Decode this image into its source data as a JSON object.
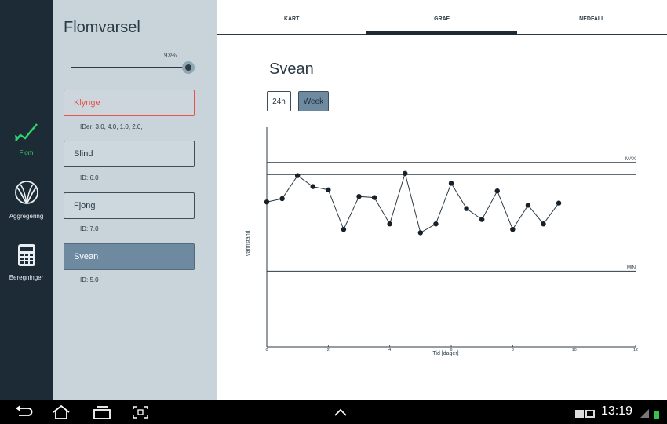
{
  "nav": {
    "items": [
      {
        "label": "Flom",
        "icon": "flood-line-icon",
        "active": true
      },
      {
        "label": "Aggregering",
        "icon": "aggregate-circles-icon",
        "active": false
      },
      {
        "label": "Beregninger",
        "icon": "calculator-icon",
        "active": false
      }
    ]
  },
  "panel": {
    "title": "Flomvarsel",
    "zoom_value": "93%",
    "zoom_fraction": 0.93,
    "stations": [
      {
        "name": "Klynge",
        "id_text": "IDer: 3.0, 4.0, 1.0, 2.0,",
        "state": "alert"
      },
      {
        "name": "Slind",
        "id_text": "ID: 6.0",
        "state": "normal"
      },
      {
        "name": "Fjong",
        "id_text": "ID: 7.0",
        "state": "normal"
      },
      {
        "name": "Svean",
        "id_text": "ID: 5.0",
        "state": "selected"
      }
    ]
  },
  "tabs": [
    {
      "label": "KART",
      "active": false
    },
    {
      "label": "GRAF",
      "active": true
    },
    {
      "label": "NEDFALL",
      "active": false
    }
  ],
  "main": {
    "station_title": "Svean",
    "range_buttons": [
      "24h",
      "Week"
    ],
    "selected_range": "Week"
  },
  "chart_data": {
    "type": "line",
    "xlabel": "Tid [dager]",
    "ylabel": "Vannstand",
    "xlim": [
      0,
      12
    ],
    "xticks": [
      0,
      2,
      4,
      6,
      8,
      10,
      12
    ],
    "ylim": [
      0,
      1
    ],
    "series": [
      {
        "x": [
          0,
          0.5,
          1,
          1.5,
          2,
          2.5,
          3,
          3.5,
          4,
          4.5,
          5,
          5.5,
          6,
          6.5,
          7,
          7.5,
          8,
          8.5,
          9,
          9.5
        ],
        "y": [
          0.66,
          0.675,
          0.78,
          0.73,
          0.715,
          0.535,
          0.685,
          0.68,
          0.56,
          0.79,
          0.52,
          0.56,
          0.745,
          0.63,
          0.58,
          0.71,
          0.535,
          0.645,
          0.56,
          0.655
        ]
      }
    ],
    "reference_lines": [
      {
        "label": "MAX",
        "y": 0.84
      },
      {
        "label": "",
        "y": 0.785
      },
      {
        "label": "MIN",
        "y": 0.345
      }
    ],
    "colors": {
      "line": "#2c3a44",
      "point": "#15202a"
    }
  },
  "statusbar": {
    "time": "13:19"
  },
  "colors": {
    "rail_bg": "#1c2b35",
    "panel_bg": "#c8d3da",
    "accent_green": "#2fd36b",
    "alert_red": "#e2554a",
    "selected_blue": "#6e8aa1"
  }
}
